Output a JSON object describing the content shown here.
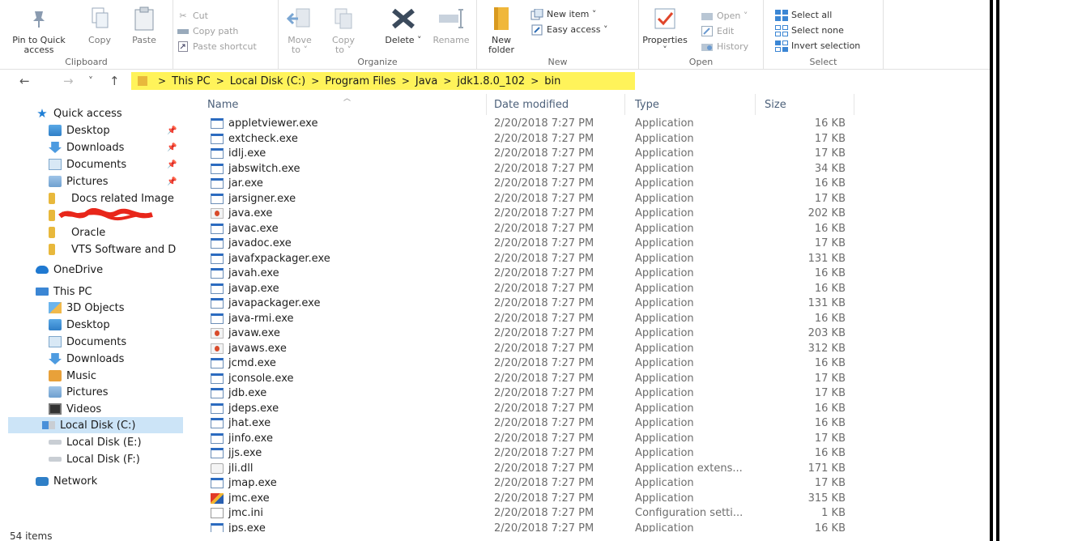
{
  "ribbon": {
    "clipboard": {
      "label": "Clipboard",
      "pin_label": "Pin to Quick access",
      "copy_label": "Copy",
      "paste_label": "Paste",
      "cut_label": "Cut",
      "copy_path_label": "Copy path",
      "paste_shortcut_label": "Paste shortcut"
    },
    "organize": {
      "label": "Organize",
      "move_to_label": "Move to ˅",
      "copy_to_label": "Copy to ˅",
      "delete_label": "Delete ˅",
      "rename_label": "Rename"
    },
    "new": {
      "label": "New",
      "new_folder_label": "New folder",
      "new_item_label": "New item ˅",
      "easy_access_label": "Easy access ˅"
    },
    "open": {
      "label": "Open",
      "properties_label": "Properties ˅",
      "open_label": "Open ˅",
      "edit_label": "Edit",
      "history_label": "History"
    },
    "select": {
      "label": "Select",
      "select_all_label": "Select all",
      "select_none_label": "Select none",
      "invert_selection_label": "Invert selection"
    }
  },
  "navigation": {
    "back_icon": "←",
    "forward_icon": "→",
    "recent_icon": "˅",
    "up_icon": "↑",
    "breadcrumb": [
      "This PC",
      "Local Disk (C:)",
      "Program Files",
      "Java",
      "jdk1.8.0_102",
      "bin"
    ],
    "separator": ">"
  },
  "sidebar": {
    "quick_access": "Quick access",
    "quick_items": [
      "Desktop",
      "Downloads",
      "Documents",
      "Pictures",
      "Docs related Image",
      "Oracle",
      "VTS Software and D"
    ],
    "onedrive": "OneDrive",
    "this_pc": "This PC",
    "pc_items": [
      "3D Objects",
      "Desktop",
      "Documents",
      "Downloads",
      "Music",
      "Pictures",
      "Videos",
      "Local Disk (C:)",
      "Local Disk (E:)",
      "Local Disk (F:)"
    ],
    "network": "Network"
  },
  "columns": {
    "name": "Name",
    "date": "Date modified",
    "type": "Type",
    "size": "Size"
  },
  "files": [
    {
      "name": "appletviewer.exe",
      "date": "2/20/2018 7:27 PM",
      "type": "Application",
      "size": "16 KB",
      "icon": "app-icon"
    },
    {
      "name": "extcheck.exe",
      "date": "2/20/2018 7:27 PM",
      "type": "Application",
      "size": "17 KB",
      "icon": "app-icon"
    },
    {
      "name": "idlj.exe",
      "date": "2/20/2018 7:27 PM",
      "type": "Application",
      "size": "17 KB",
      "icon": "app-icon"
    },
    {
      "name": "jabswitch.exe",
      "date": "2/20/2018 7:27 PM",
      "type": "Application",
      "size": "34 KB",
      "icon": "app-icon"
    },
    {
      "name": "jar.exe",
      "date": "2/20/2018 7:27 PM",
      "type": "Application",
      "size": "16 KB",
      "icon": "app-icon"
    },
    {
      "name": "jarsigner.exe",
      "date": "2/20/2018 7:27 PM",
      "type": "Application",
      "size": "17 KB",
      "icon": "app-icon"
    },
    {
      "name": "java.exe",
      "date": "2/20/2018 7:27 PM",
      "type": "Application",
      "size": "202 KB",
      "icon": "java-icon"
    },
    {
      "name": "javac.exe",
      "date": "2/20/2018 7:27 PM",
      "type": "Application",
      "size": "16 KB",
      "icon": "app-icon"
    },
    {
      "name": "javadoc.exe",
      "date": "2/20/2018 7:27 PM",
      "type": "Application",
      "size": "17 KB",
      "icon": "app-icon"
    },
    {
      "name": "javafxpackager.exe",
      "date": "2/20/2018 7:27 PM",
      "type": "Application",
      "size": "131 KB",
      "icon": "app-icon"
    },
    {
      "name": "javah.exe",
      "date": "2/20/2018 7:27 PM",
      "type": "Application",
      "size": "16 KB",
      "icon": "app-icon"
    },
    {
      "name": "javap.exe",
      "date": "2/20/2018 7:27 PM",
      "type": "Application",
      "size": "16 KB",
      "icon": "app-icon"
    },
    {
      "name": "javapackager.exe",
      "date": "2/20/2018 7:27 PM",
      "type": "Application",
      "size": "131 KB",
      "icon": "app-icon"
    },
    {
      "name": "java-rmi.exe",
      "date": "2/20/2018 7:27 PM",
      "type": "Application",
      "size": "16 KB",
      "icon": "app-icon"
    },
    {
      "name": "javaw.exe",
      "date": "2/20/2018 7:27 PM",
      "type": "Application",
      "size": "203 KB",
      "icon": "java-icon"
    },
    {
      "name": "javaws.exe",
      "date": "2/20/2018 7:27 PM",
      "type": "Application",
      "size": "312 KB",
      "icon": "java-icon"
    },
    {
      "name": "jcmd.exe",
      "date": "2/20/2018 7:27 PM",
      "type": "Application",
      "size": "16 KB",
      "icon": "app-icon"
    },
    {
      "name": "jconsole.exe",
      "date": "2/20/2018 7:27 PM",
      "type": "Application",
      "size": "17 KB",
      "icon": "app-icon"
    },
    {
      "name": "jdb.exe",
      "date": "2/20/2018 7:27 PM",
      "type": "Application",
      "size": "17 KB",
      "icon": "app-icon"
    },
    {
      "name": "jdeps.exe",
      "date": "2/20/2018 7:27 PM",
      "type": "Application",
      "size": "16 KB",
      "icon": "app-icon"
    },
    {
      "name": "jhat.exe",
      "date": "2/20/2018 7:27 PM",
      "type": "Application",
      "size": "16 KB",
      "icon": "app-icon"
    },
    {
      "name": "jinfo.exe",
      "date": "2/20/2018 7:27 PM",
      "type": "Application",
      "size": "17 KB",
      "icon": "app-icon"
    },
    {
      "name": "jjs.exe",
      "date": "2/20/2018 7:27 PM",
      "type": "Application",
      "size": "16 KB",
      "icon": "app-icon"
    },
    {
      "name": "jli.dll",
      "date": "2/20/2018 7:27 PM",
      "type": "Application extens...",
      "size": "171 KB",
      "icon": "dll-icon"
    },
    {
      "name": "jmap.exe",
      "date": "2/20/2018 7:27 PM",
      "type": "Application",
      "size": "17 KB",
      "icon": "app-icon"
    },
    {
      "name": "jmc.exe",
      "date": "2/20/2018 7:27 PM",
      "type": "Application",
      "size": "315 KB",
      "icon": "jmc-icon"
    },
    {
      "name": "jmc.ini",
      "date": "2/20/2018 7:27 PM",
      "type": "Configuration setti...",
      "size": "1 KB",
      "icon": "ini-icon"
    },
    {
      "name": "jps.exe",
      "date": "2/20/2018 7:27 PM",
      "type": "Application",
      "size": "16 KB",
      "icon": "app-icon"
    }
  ],
  "status": {
    "item_count": "54 items"
  },
  "colors": {
    "address_highlight": "#fff35a",
    "selected_item": "#cce4f7",
    "folder_yellow": "#e8b83c",
    "header_text": "#4c607a"
  }
}
